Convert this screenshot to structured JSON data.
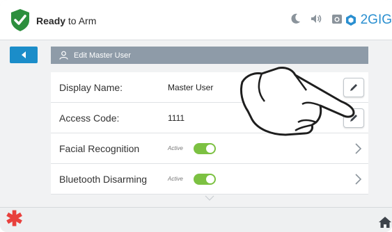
{
  "status": {
    "prefix": "Rea",
    "bold": "dy",
    "rest": " to Arm",
    "shield_color": "#2d8f3e"
  },
  "top_icons": [
    "moon-icon",
    "volume-icon",
    "camera-icon"
  ],
  "brand": {
    "name": "2GIG",
    "color": "#2a8fd0"
  },
  "nav": {
    "back_icon": "back-arrow-icon"
  },
  "edit_header": {
    "title": "Edit Master User",
    "icon": "user-icon"
  },
  "rows": [
    {
      "label": "Display Name:",
      "value": "Master User",
      "control": "edit"
    },
    {
      "label": "Access Code:",
      "value": "1111",
      "control": "edit"
    },
    {
      "label": "Facial Recognition",
      "state_text": "Active",
      "toggle_on": true,
      "control": "chevron"
    },
    {
      "label": "Bluetooth Disarming",
      "state_text": "Active",
      "toggle_on": true,
      "control": "chevron"
    }
  ],
  "accent_colors": {
    "toggle": "#7cc142",
    "back_button": "#1b8dc9",
    "asterisk": "#e8413d"
  },
  "bottom": {
    "left_icon": "asterisk-icon",
    "right_icon": "home-icon"
  }
}
